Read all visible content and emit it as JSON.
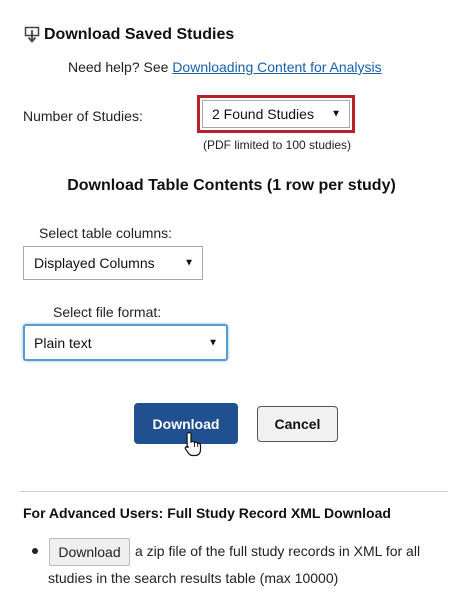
{
  "header": {
    "title": "Download Saved Studies",
    "help_prefix": "Need help? See",
    "help_link": "Downloading Content for Analysis"
  },
  "studies": {
    "label": "Number of Studies:",
    "selected": "2 Found Studies",
    "note": "(PDF limited to 100 studies)"
  },
  "table": {
    "title": "Download Table Contents (1 row per study)",
    "columns_label": "Select table columns:",
    "columns_selected": "Displayed Columns",
    "format_label": "Select file format:",
    "format_selected": "Plain text"
  },
  "actions": {
    "download_label": "Download",
    "cancel_label": "Cancel"
  },
  "advanced": {
    "title": "For Advanced Users: Full Study Record XML Download",
    "button_label": "Download",
    "desc_line1": "a zip file of the full study records in XML for all",
    "desc_line2": "studies in the search results table (max 10000)"
  },
  "colors": {
    "primary_button": "#20508f",
    "highlight_border": "#b8202e",
    "focus_border": "#5b9bd5",
    "link": "#1a5fa8"
  }
}
